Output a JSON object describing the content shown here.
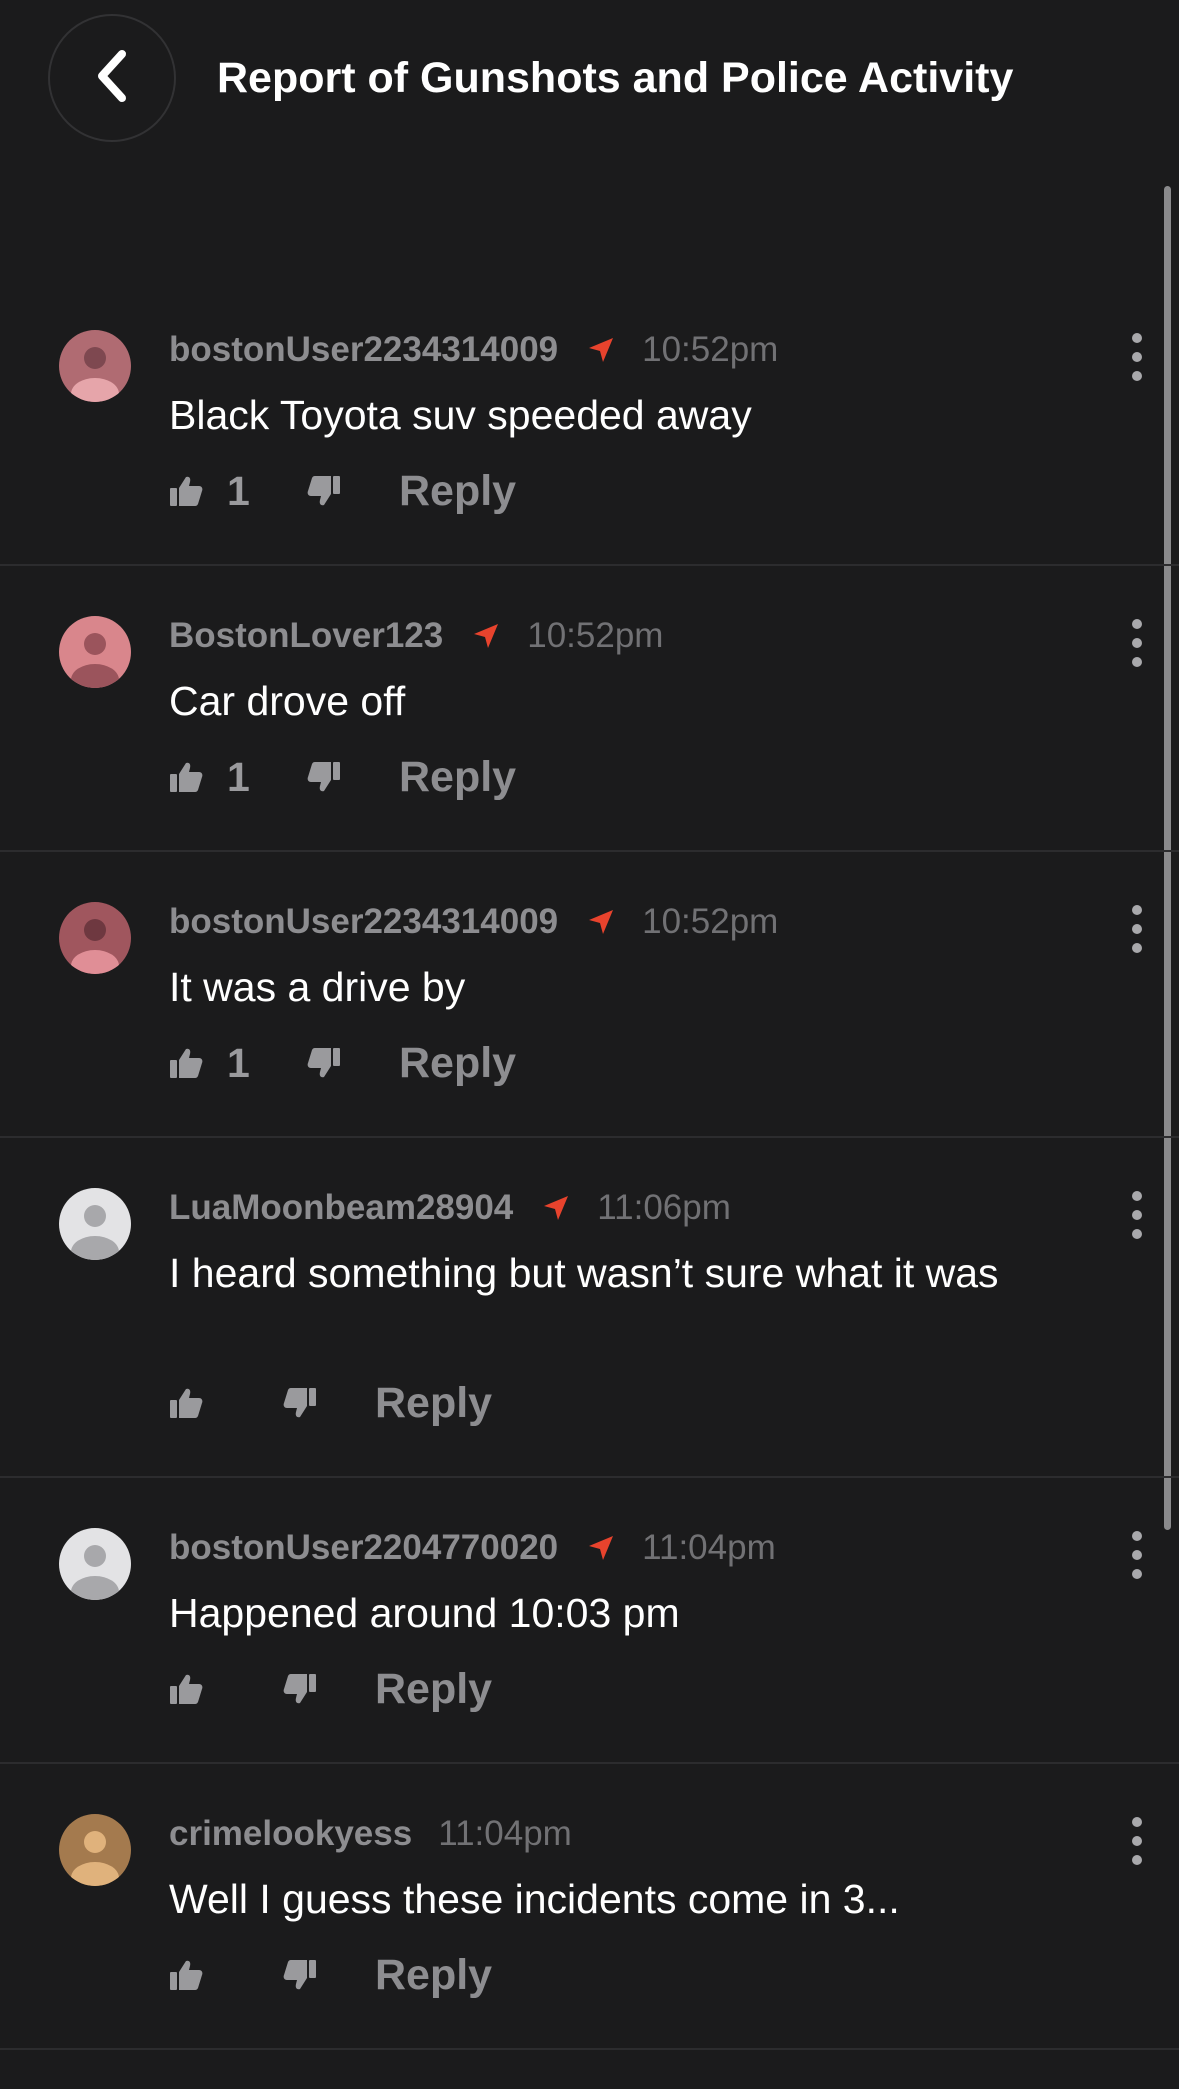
{
  "header": {
    "title": "Report of Gunshots and Police Activity",
    "back_icon": "chevron-left-icon"
  },
  "colors": {
    "background": "#1b1b1c",
    "location_arrow": "#e8432d",
    "avatar_pink": "#b06b72",
    "avatar_gray": "#cfcfd1",
    "avatar_tan": "#a47a4e"
  },
  "comments": [
    {
      "username": "bostonUser2234314009",
      "has_location": true,
      "time": "10:52pm",
      "text": "Black Toyota suv speeded away",
      "likes": "1",
      "reply_label": "Reply",
      "avatar": "pink"
    },
    {
      "username": "BostonLover123",
      "has_location": true,
      "time": "10:52pm",
      "text": "Car drove off",
      "likes": "1",
      "reply_label": "Reply",
      "avatar": "pink"
    },
    {
      "username": "bostonUser2234314009",
      "has_location": true,
      "time": "10:52pm",
      "text": "It was a drive by",
      "likes": "1",
      "reply_label": "Reply",
      "avatar": "pink"
    },
    {
      "username": "LuaMoonbeam28904",
      "has_location": true,
      "time": "11:06pm",
      "text": "I heard something but wasn’t sure what it was",
      "likes": "",
      "reply_label": "Reply",
      "avatar": "gray"
    },
    {
      "username": "bostonUser2204770020",
      "has_location": true,
      "time": "11:04pm",
      "text": "Happened around 10:03 pm",
      "likes": "",
      "reply_label": "Reply",
      "avatar": "gray"
    },
    {
      "username": "crimelookyess",
      "has_location": false,
      "time": "11:04pm",
      "text": "Well I guess these incidents come in 3...",
      "likes": "",
      "reply_label": "Reply",
      "avatar": "tan"
    }
  ]
}
